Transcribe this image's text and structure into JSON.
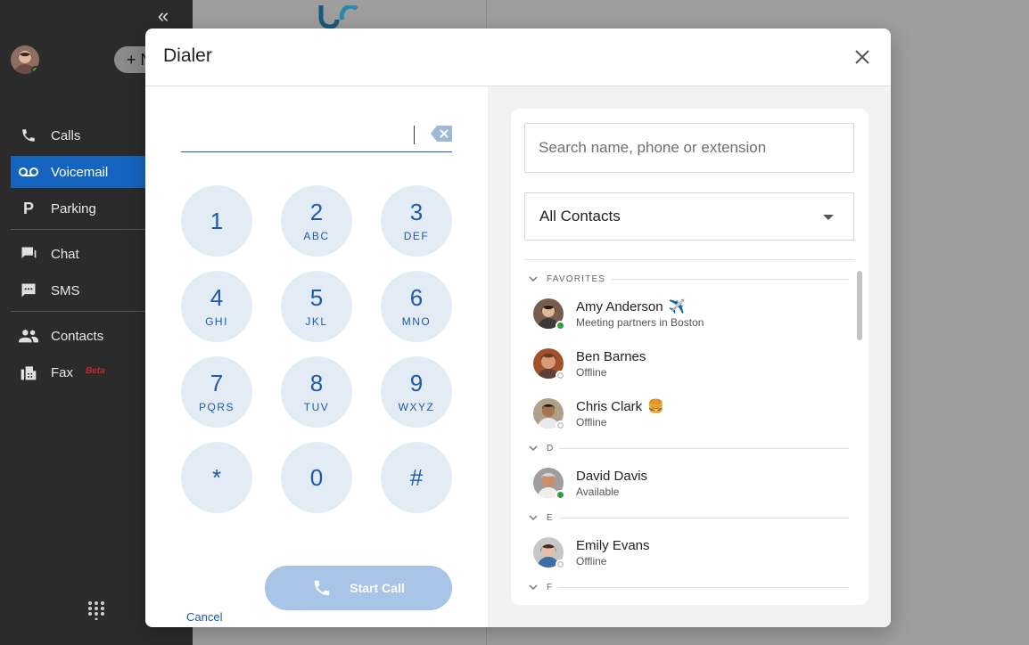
{
  "app": {
    "nav": [
      {
        "label": "Calls",
        "icon": "phone-icon"
      },
      {
        "label": "Voicemail",
        "icon": "voicemail-icon",
        "active": true
      },
      {
        "label": "Parking",
        "icon": "parking-icon"
      },
      {
        "label": "Chat",
        "icon": "chat-icon"
      },
      {
        "label": "SMS",
        "icon": "sms-icon"
      },
      {
        "label": "Contacts",
        "icon": "contacts-icon"
      },
      {
        "label": "Fax",
        "icon": "fax-icon",
        "badge": "Beta"
      }
    ],
    "new_button": "+ N",
    "collapse_glyph": "«"
  },
  "dialer": {
    "title": "Dialer",
    "number_value": "",
    "keys": [
      {
        "digit": "1",
        "letters": ""
      },
      {
        "digit": "2",
        "letters": "ABC"
      },
      {
        "digit": "3",
        "letters": "DEF"
      },
      {
        "digit": "4",
        "letters": "GHI"
      },
      {
        "digit": "5",
        "letters": "JKL"
      },
      {
        "digit": "6",
        "letters": "MNO"
      },
      {
        "digit": "7",
        "letters": "PQRS"
      },
      {
        "digit": "8",
        "letters": "TUV"
      },
      {
        "digit": "9",
        "letters": "WXYZ"
      },
      {
        "digit": "*",
        "letters": ""
      },
      {
        "digit": "0",
        "letters": ""
      },
      {
        "digit": "#",
        "letters": ""
      }
    ],
    "cancel_label": "Cancel",
    "start_call_label": "Start Call"
  },
  "contacts": {
    "search_placeholder": "Search name, phone or extension",
    "filter_value": "All Contacts",
    "groups": [
      {
        "label": "FAVORITES",
        "items": [
          {
            "name": "Amy Anderson",
            "emoji": "✈️",
            "status": "Meeting partners in Boston",
            "presence": "online"
          },
          {
            "name": "Ben Barnes",
            "emoji": "",
            "status": "Offline",
            "presence": "offline"
          },
          {
            "name": "Chris Clark",
            "emoji": "🍔",
            "status": "Offline",
            "presence": "offline"
          }
        ]
      },
      {
        "label": "D",
        "items": [
          {
            "name": "David Davis",
            "emoji": "",
            "status": "Available",
            "presence": "online"
          }
        ]
      },
      {
        "label": "E",
        "items": [
          {
            "name": "Emily Evans",
            "emoji": "",
            "status": "Offline",
            "presence": "offline"
          }
        ]
      },
      {
        "label": "F",
        "items": []
      }
    ]
  },
  "colors": {
    "accent": "#1e5aa8",
    "key_bg": "#e3ecf5",
    "start_call_bg": "#a8c4e6",
    "sidebar_bg": "#2b2b2b",
    "nav_active": "#1565c0",
    "online": "#2e9e3a"
  }
}
